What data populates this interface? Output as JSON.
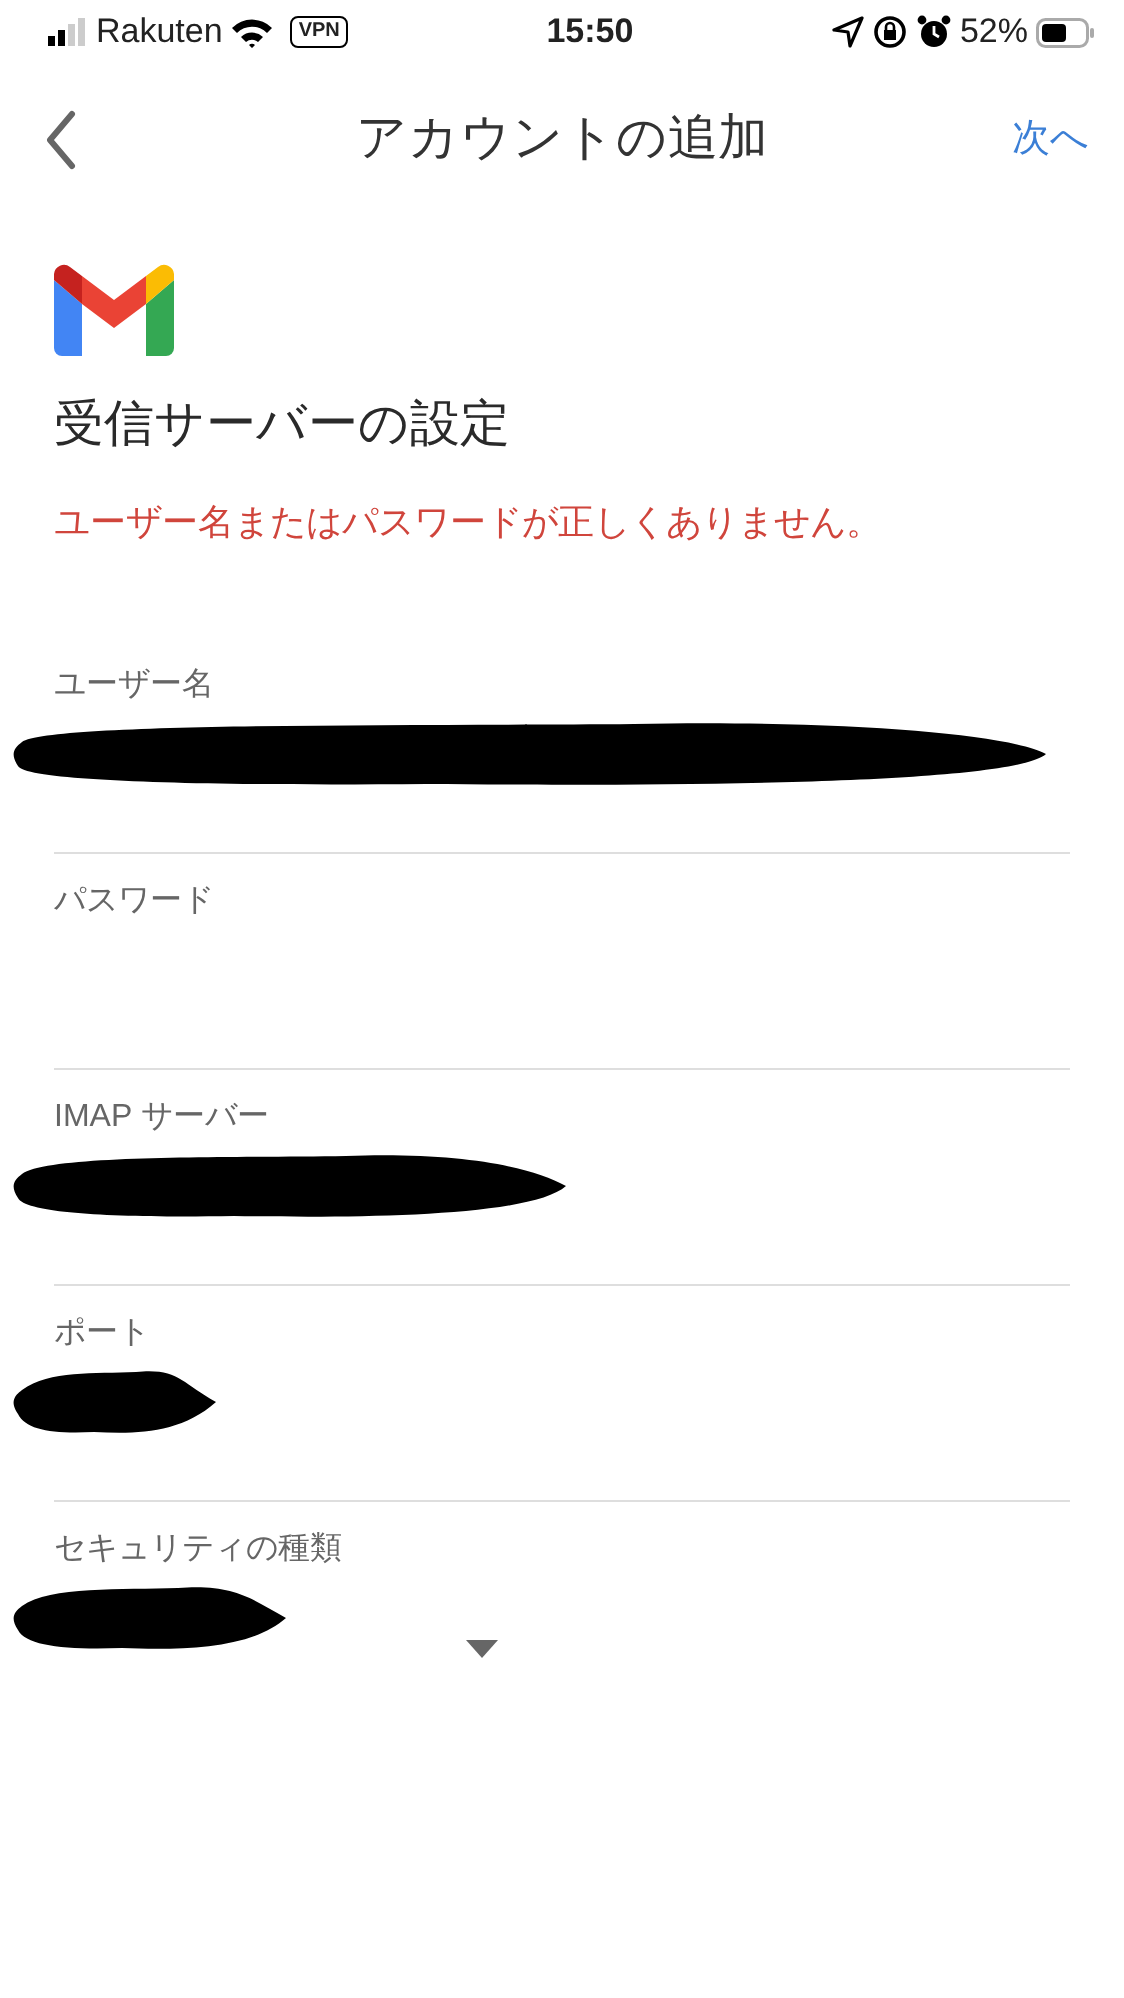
{
  "status_bar": {
    "carrier": "Rakuten",
    "vpn": "VPN",
    "time": "15:50",
    "battery": "52%"
  },
  "header": {
    "title": "アカウントの追加",
    "next": "次へ"
  },
  "heading": "受信サーバーの設定",
  "error": "ユーザー名またはパスワードが正しくありません。",
  "fields": [
    {
      "label": "ユーザー名",
      "kind": "text",
      "redacted": true
    },
    {
      "label": "パスワード",
      "kind": "text",
      "redacted": false
    },
    {
      "label": "IMAP サーバー",
      "kind": "text",
      "redacted": true
    },
    {
      "label": "ポート",
      "kind": "text",
      "redacted": true
    },
    {
      "label": "セキュリティの種類",
      "kind": "dropdown",
      "redacted": true
    }
  ]
}
